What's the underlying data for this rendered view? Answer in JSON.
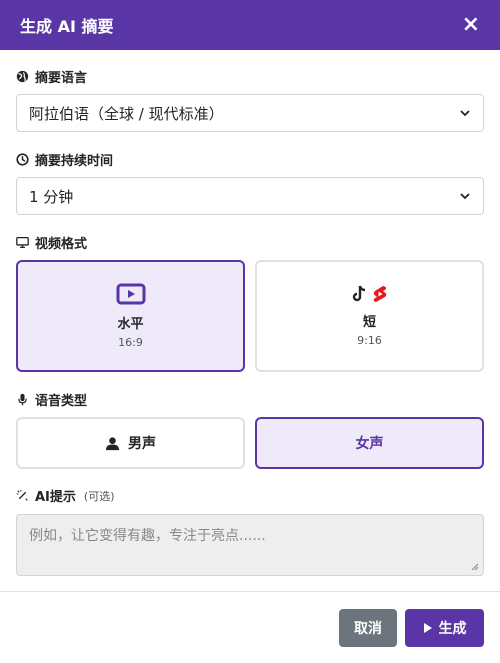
{
  "dialog": {
    "title": "生成 AI 摘要",
    "close_label": "×"
  },
  "language": {
    "label": "摘要语言",
    "icon": "globe-icon",
    "selected": "阿拉伯语（全球 / 现代标准）"
  },
  "duration": {
    "label": "摘要持续时间",
    "icon": "clock-icon",
    "selected": "1 分钟"
  },
  "video_format": {
    "label": "视频格式",
    "icon": "monitor-icon",
    "options": [
      {
        "name": "水平",
        "ratio": "16:9",
        "icon": "youtube-play-icon",
        "selected": true
      },
      {
        "name": "短",
        "ratio": "9:16",
        "icon": "tiktok-shorts-icon",
        "selected": false
      }
    ]
  },
  "voice_type": {
    "label": "语音类型",
    "icon": "microphone-icon",
    "options": [
      {
        "name": "男声",
        "icon": "user-icon",
        "selected": false
      },
      {
        "name": "女声",
        "selected": true
      }
    ]
  },
  "ai_prompt": {
    "label": "AI提示",
    "optional": "(可选)",
    "icon": "magic-wand-icon",
    "placeholder": "例如，让它变得有趣，专注于亮点......"
  },
  "footer": {
    "cancel_label": "取消",
    "generate_label": "生成"
  },
  "colors": {
    "primary": "#5a35a6",
    "selected_bg": "#efeaf9",
    "secondary": "#6c757d"
  }
}
